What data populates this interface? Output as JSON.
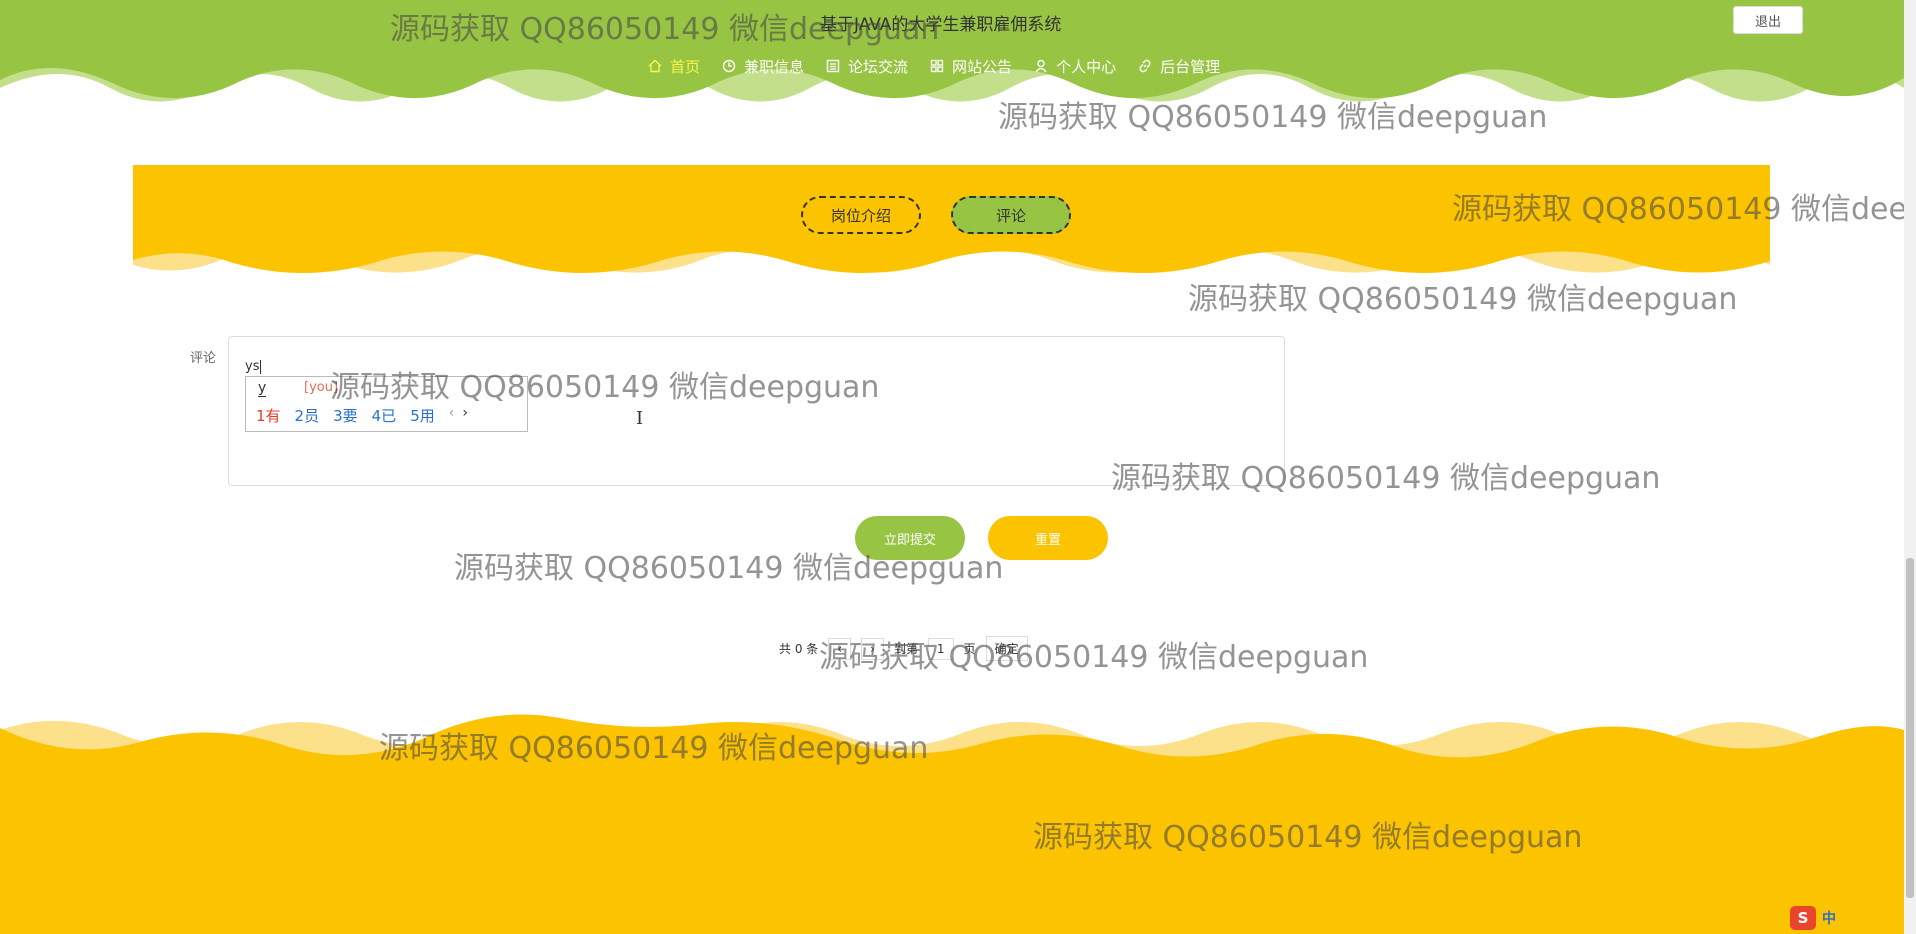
{
  "colors": {
    "green": "#98c444",
    "yellow": "#fcc300",
    "active_nav": "#f8f64a"
  },
  "header": {
    "title": "基于JAVA的大学生兼职雇佣系统",
    "logout": "退出"
  },
  "nav": [
    {
      "label": "首页",
      "icon": "home-icon",
      "active": true
    },
    {
      "label": "兼职信息",
      "icon": "clock-icon"
    },
    {
      "label": "论坛交流",
      "icon": "list-icon"
    },
    {
      "label": "网站公告",
      "icon": "grid-icon"
    },
    {
      "label": "个人中心",
      "icon": "user-icon"
    },
    {
      "label": "后台管理",
      "icon": "link-icon"
    }
  ],
  "tabs": {
    "intro": "岗位介绍",
    "comment": "评论"
  },
  "form": {
    "label": "评论",
    "value": "ys",
    "submit": "立即提交",
    "reset": "重置"
  },
  "ime": {
    "pinyin": "y",
    "hint": "[you]",
    "candidates": [
      "1有",
      "2员",
      "3要",
      "4已",
      "5用"
    ],
    "prev": "‹",
    "next": "›"
  },
  "pager": {
    "total": "共 0 条",
    "goto": "到第",
    "page_input": "1",
    "page_unit": "页",
    "confirm": "确定"
  },
  "watermark": "源码获取 QQ86050149 微信deepguan",
  "taskbar": {
    "ime_logo": "S",
    "lang": "中"
  }
}
